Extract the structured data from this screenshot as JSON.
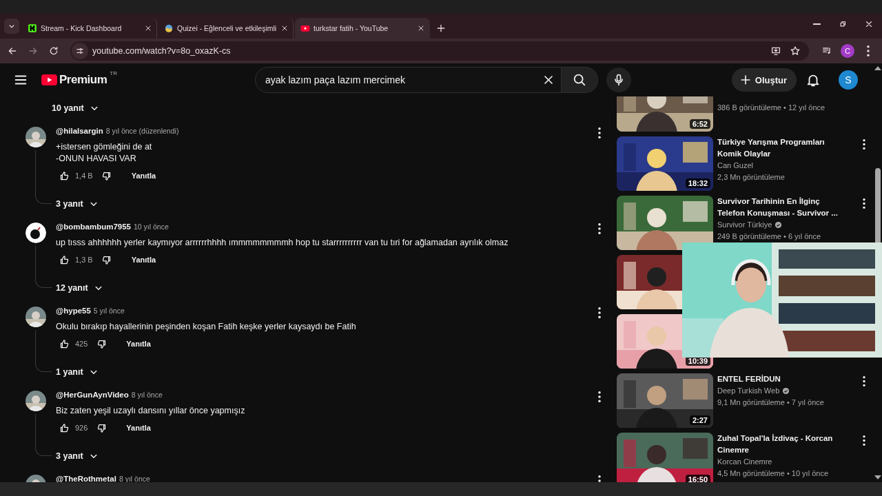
{
  "browser": {
    "tabs": [
      {
        "title": "Stream - Kick Dashboard",
        "kind": "kick",
        "selected": false
      },
      {
        "title": "Quizei - Eğlenceli ve etkileşimli",
        "kind": "quiz",
        "selected": false
      },
      {
        "title": "turkstar fatih - YouTube",
        "kind": "youtube",
        "selected": true
      }
    ],
    "url": "youtube.com/watch?v=8o_oxazK-cs",
    "profile_initial": "C"
  },
  "header": {
    "logo_text": "Premium",
    "region": "TR",
    "search": {
      "value": "ayak lazım paça lazım mercimek"
    },
    "create_label": "Oluştur",
    "avatar_initial": "S"
  },
  "comments": {
    "top_replies": "10 yanıt",
    "items": [
      {
        "author": "@hilalsargin",
        "time": "8 yıl önce (düzenlendi)",
        "text": "+istersen gömleğini de at\n-ONUN HAVASI VAR",
        "likes": "1,4 B",
        "reply": "Yanıtla",
        "replies": "3 yanıt"
      },
      {
        "kind": "bomb",
        "author": "@bombambum7955",
        "time": "10 yıl önce",
        "text": "up tısss ahhhhhh yerler kaymıyor arrrrrrhhhh ımmmmmmmmh hop tu starrrrrrrrrr van tu tıri for ağlamadan ayrılık olmaz",
        "likes": "1,3 B",
        "reply": "Yanıtla",
        "replies": "12 yanıt"
      },
      {
        "author": "@hype55",
        "time": "5 yıl önce",
        "text": "Okulu bırakıp hayallerinin peşinden koşan Fatih keşke yerler kaysaydı be Fatih",
        "likes": "425",
        "reply": "Yanıtla",
        "replies": "1 yanıt"
      },
      {
        "author": "@HerGunAynVideo",
        "time": "8 yıl önce",
        "text": "Biz zaten yeşil uzaylı dansını yıllar önce yapmışız",
        "likes": "926",
        "reply": "Yanıtla",
        "replies": "3 yanıt"
      },
      {
        "author": "@TheRothmetal",
        "time": "8 yıl önce"
      }
    ]
  },
  "sidebar": {
    "videos": [
      {
        "kind": "picture",
        "duration": "6:52",
        "meta": "386 B görüntüleme • 12 yıl önce"
      },
      {
        "kind": "picture",
        "duration": "18:32",
        "title": "Türkiye Yarışma Programları\nKomik Olaylar",
        "channel": "Can Guzel",
        "verified": false,
        "meta": "2,3 Mn görüntüleme"
      },
      {
        "kind": "picture",
        "title": "Survivor Tarihinin En İlginç\nTelefon Konuşması - Survivor ...",
        "channel": "Survivor Türkiye",
        "verified": true,
        "meta": "249 B görüntüleme • 6 yıl önce"
      },
      {
        "kind": "picture"
      },
      {
        "kind": "picture",
        "duration": "10:39"
      },
      {
        "kind": "picture",
        "duration": "2:27",
        "title": "ENTEL FERİDUN",
        "channel": "Deep Turkish Web",
        "verified": true,
        "meta": "9,1 Mn görüntüleme • 7 yıl önce"
      },
      {
        "kind": "picture",
        "duration": "16:50",
        "title": "Zuhal Topal'la İzdivaç - Korcan\nCinemre",
        "channel": "Korcan Cinemre",
        "verified": false,
        "meta": "4,5 Mn görüntüleme • 10 yıl önce"
      }
    ]
  },
  "overlay": {
    "kind": "picture"
  }
}
